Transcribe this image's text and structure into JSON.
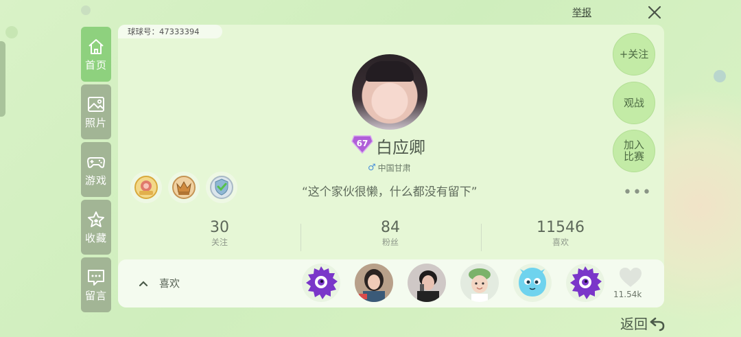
{
  "header": {
    "report_label": "举报",
    "close_icon": "close-icon"
  },
  "sidebar": {
    "items": [
      {
        "label": "首页",
        "icon": "home-icon",
        "active": true
      },
      {
        "label": "照片",
        "icon": "photo-icon",
        "active": false
      },
      {
        "label": "游戏",
        "icon": "gamepad-icon",
        "active": false
      },
      {
        "label": "收藏",
        "icon": "star-icon",
        "active": false
      },
      {
        "label": "留言",
        "icon": "message-icon",
        "active": false
      }
    ]
  },
  "profile": {
    "uid_text": "球球号：47333394",
    "level": "67",
    "username": "白应卿",
    "gender_symbol": "♂",
    "location": "中国甘肃",
    "motto": "“这个家伙很懒，什么都没有留下”",
    "more_label": "•••"
  },
  "actions": {
    "follow": "+关注",
    "watch": "观战",
    "join": "加入比赛"
  },
  "stats": [
    {
      "value": "30",
      "label": "关注"
    },
    {
      "value": "84",
      "label": "粉丝"
    },
    {
      "value": "11546",
      "label": "喜欢"
    }
  ],
  "likes": {
    "label": "喜欢",
    "count": "11.54k"
  },
  "footer": {
    "back_label": "返回"
  },
  "colors": {
    "accent": "#8ed17e",
    "sidebar_inactive": "#a2b595",
    "panel": "#e6f7d6",
    "level_badge": "#b05fd8"
  }
}
